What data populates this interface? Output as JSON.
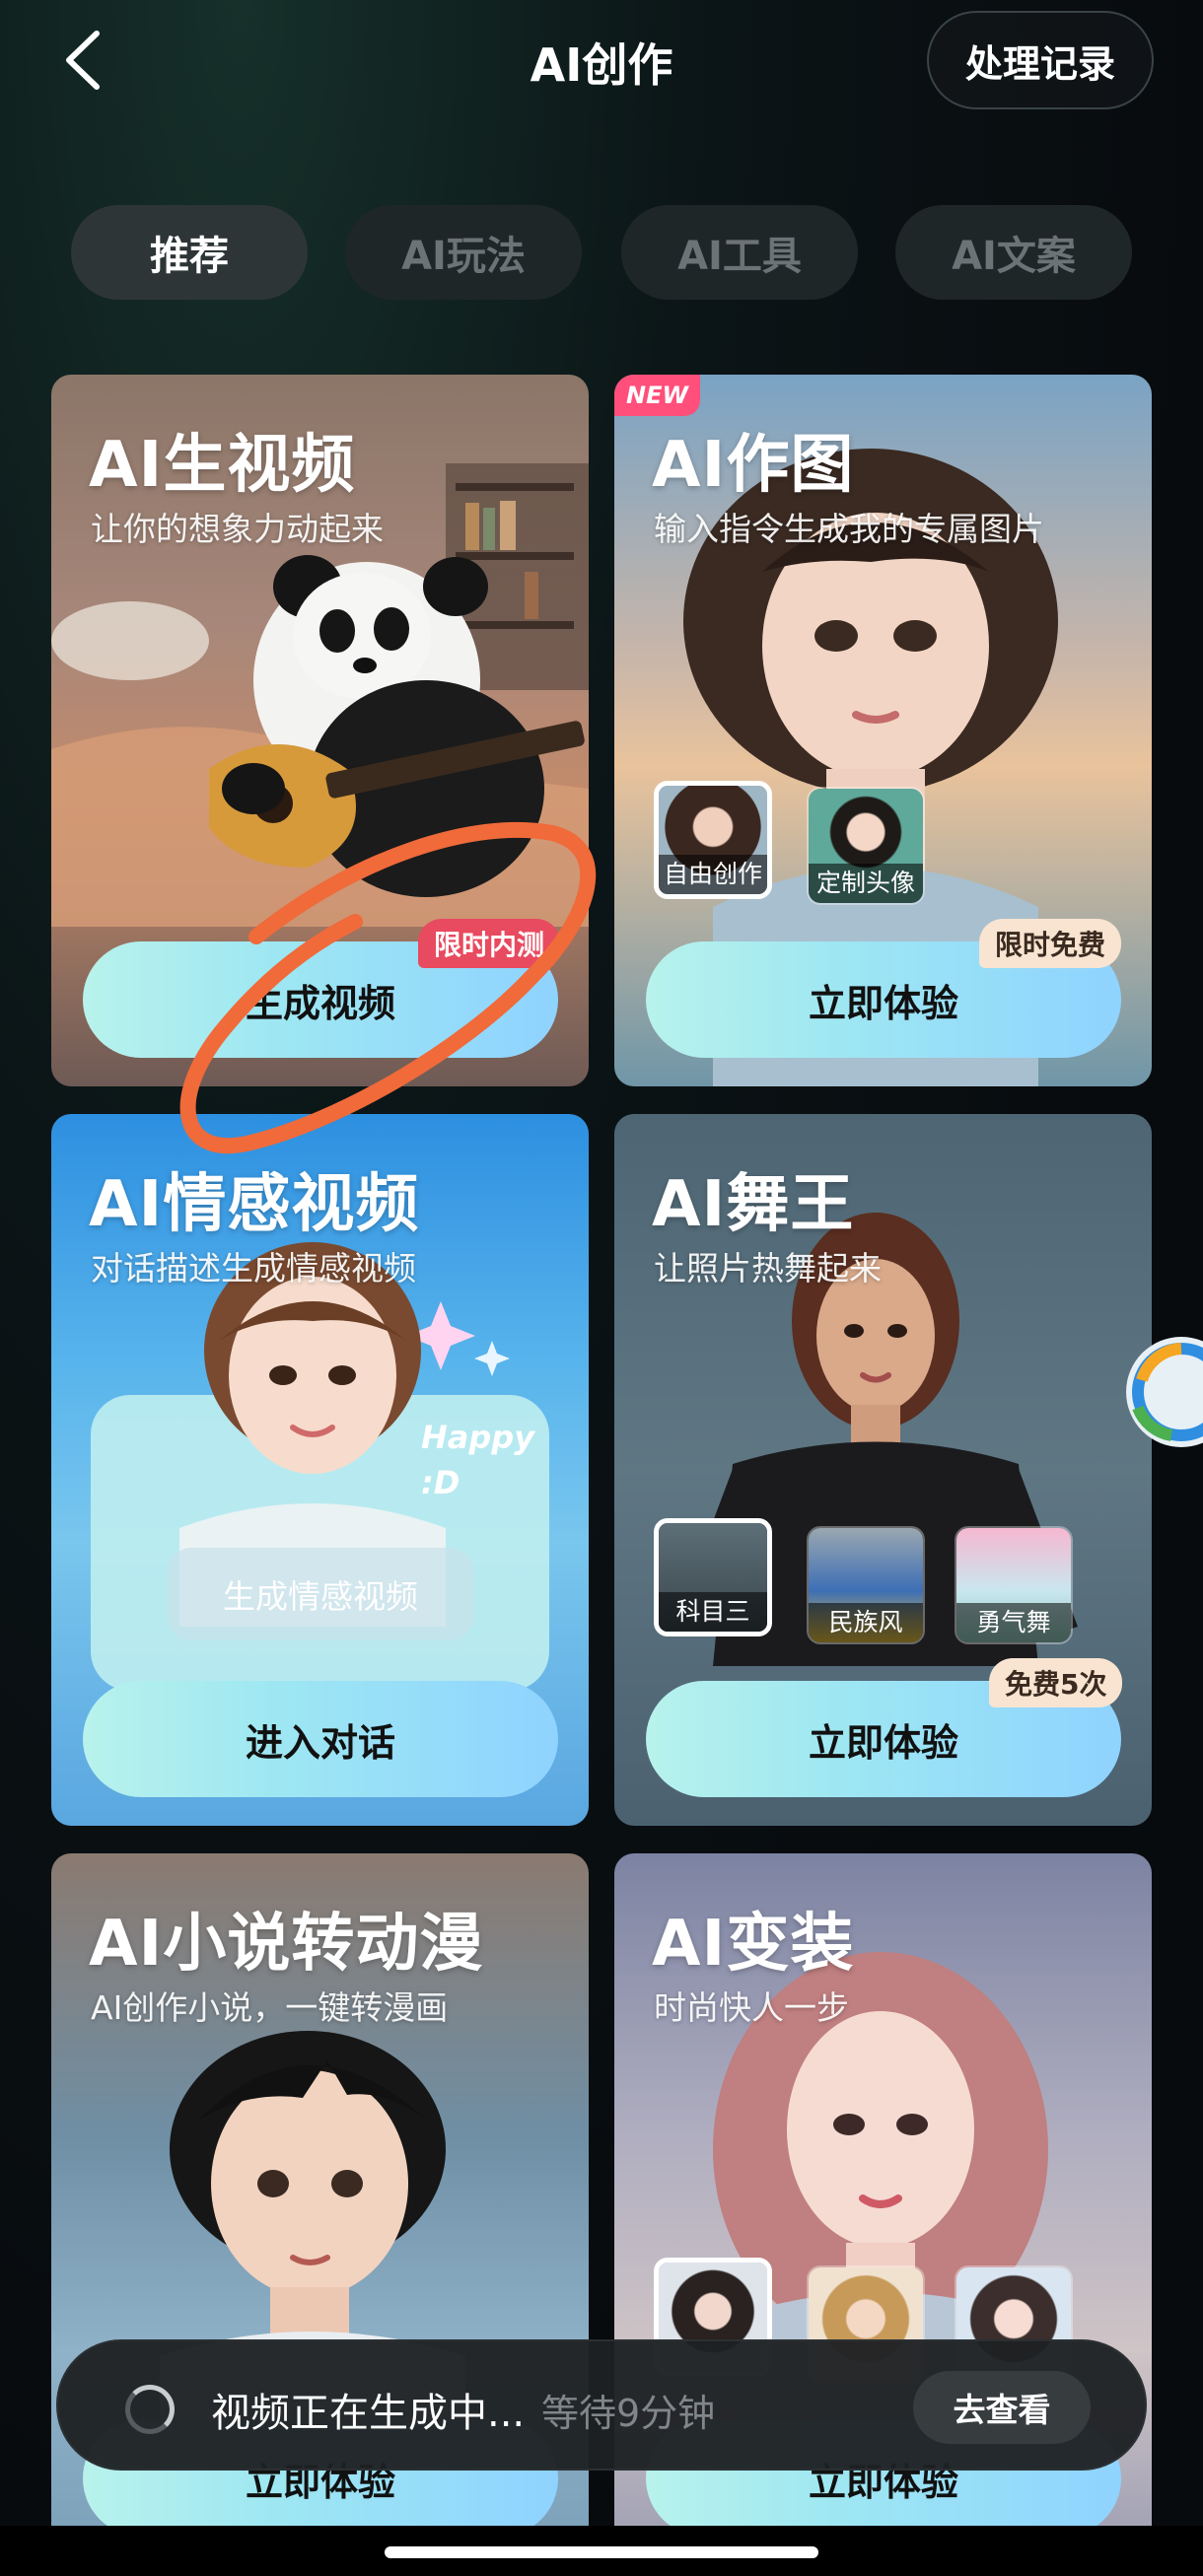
{
  "header": {
    "title": "AI创作",
    "history_label": "处理记录"
  },
  "tabs": [
    {
      "label": "推荐",
      "active": true
    },
    {
      "label": "AI玩法",
      "active": false
    },
    {
      "label": "AI工具",
      "active": false
    },
    {
      "label": "AI文案",
      "active": false
    }
  ],
  "cards": {
    "video": {
      "title": "AI生视频",
      "subtitle": "让你的想象力动起来",
      "cta": "生成视频",
      "badge": "限时内测"
    },
    "draw": {
      "new_badge": "NEW",
      "title": "AI作图",
      "subtitle": "输入指令生成我的专属图片",
      "cta": "立即体验",
      "badge": "限时免费",
      "options": [
        "自由创作",
        "定制头像"
      ]
    },
    "emotion": {
      "title": "AI情感视频",
      "subtitle": "对话描述生成情感视频",
      "cta": "进入对话",
      "bubble": "生成情感视频",
      "happy_text": "Happy :D"
    },
    "dance": {
      "title": "AI舞王",
      "subtitle": "让照片热舞起来",
      "cta": "立即体验",
      "badge": "免费5次",
      "options": [
        "科目三",
        "民族风",
        "勇气舞"
      ]
    },
    "novel": {
      "title": "AI小说转动漫",
      "subtitle": "AI创作小说，一键转漫画",
      "cta": "立即体验"
    },
    "dressup": {
      "title": "AI变装",
      "subtitle": "时尚快人一步",
      "cta": "立即体验"
    }
  },
  "toast": {
    "message": "视频正在生成中...",
    "wait": "等待9分钟",
    "action": "去查看"
  },
  "colors": {
    "cta_gradient_start": "#b8f2ec",
    "cta_gradient_end": "#8fd3ff",
    "annotation_stroke": "#f06a3a",
    "badge_red": "#e84a5f"
  }
}
